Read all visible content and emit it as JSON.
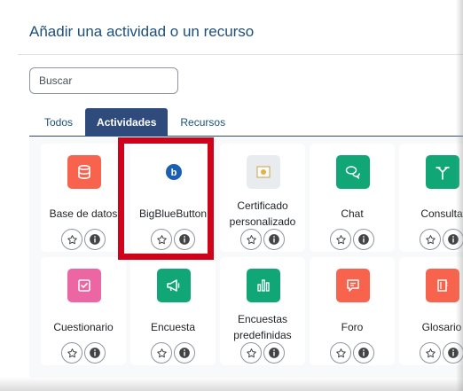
{
  "modal": {
    "title": "Añadir una actividad o un recurso"
  },
  "search": {
    "placeholder": "Buscar"
  },
  "tabs": [
    {
      "label": "Todos",
      "active": false
    },
    {
      "label": "Actividades",
      "active": true
    },
    {
      "label": "Recursos",
      "active": false
    }
  ],
  "activities": [
    {
      "label": "Base de datos",
      "icon": "database-icon",
      "color": "#f7634d"
    },
    {
      "label": "BigBlueButton",
      "icon": "bigbluebutton-icon",
      "color": "#1a5fb4",
      "highlighted": true
    },
    {
      "label": "Certificado personalizado",
      "icon": "certificate-icon",
      "color": "#e9ecef"
    },
    {
      "label": "Chat",
      "icon": "chat-icon",
      "color": "#11a676"
    },
    {
      "label": "Consulta",
      "icon": "choice-icon",
      "color": "#11a676"
    },
    {
      "label": "Cuestionario",
      "icon": "quiz-icon",
      "color": "#eb66a2"
    },
    {
      "label": "Encuesta",
      "icon": "megaphone-icon",
      "color": "#11a676"
    },
    {
      "label": "Encuestas predefinidas",
      "icon": "survey-icon",
      "color": "#11a676"
    },
    {
      "label": "Foro",
      "icon": "forum-icon",
      "color": "#f7634d"
    },
    {
      "label": "Glosario",
      "icon": "glossary-icon",
      "color": "#f7634d"
    }
  ],
  "colors": {
    "highlight": "#d0021b",
    "tab_active": "#2f4b7c",
    "link": "#1d4f7a"
  }
}
